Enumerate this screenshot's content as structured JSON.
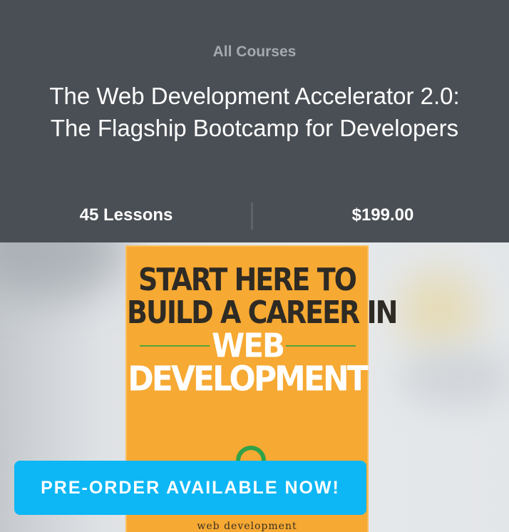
{
  "header": {
    "breadcrumb": "All Courses",
    "title_line1": "The Web Development Accelerator 2.0:",
    "title_line2": "The Flagship Bootcamp for Developers"
  },
  "stats": {
    "lessons": "45 Lessons",
    "price": "$199.00"
  },
  "book_cover": {
    "line1": "START HERE TO",
    "line2": "BUILD A CAREER IN",
    "line3": "WEB",
    "line4": "DEVELOPMENT",
    "footer": "web development",
    "colors": {
      "cover": "#f6a933",
      "accent": "#2fa24a"
    }
  },
  "cta": {
    "label": "PRE-ORDER AVAILABLE NOW!",
    "color": "#0db7f5"
  },
  "colors": {
    "header_bg": "#4a4f55",
    "breadcrumb": "#a4a9ad"
  }
}
